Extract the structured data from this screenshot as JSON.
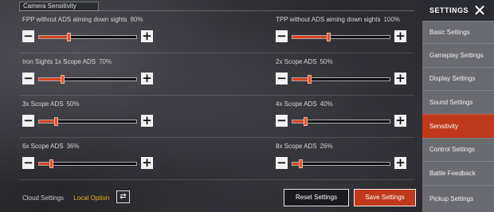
{
  "section_title": "Camera Sensitivity",
  "settings": [
    {
      "label": "FPP without ADS aiming down sights",
      "value": "80%",
      "level": 0.3
    },
    {
      "label": "TPP without ADS aiming down sights",
      "value": "100%",
      "level": 0.37
    },
    {
      "label": "Iron Sights 1x Scope ADS",
      "value": "70%",
      "level": 0.24
    },
    {
      "label": "2x Scope ADS",
      "value": "50%",
      "level": 0.17
    },
    {
      "label": "3x Scope ADS",
      "value": "50%",
      "level": 0.17
    },
    {
      "label": "4x Scope ADS",
      "value": "40%",
      "level": 0.13
    },
    {
      "label": "6x Scope ADS",
      "value": "36%",
      "level": 0.12
    },
    {
      "label": "8x Scope ADS",
      "value": "26%",
      "level": 0.08
    }
  ],
  "footer": {
    "cloud_label": "Cloud Settings",
    "local_option": "Local Option",
    "reset_label": "Reset Settings",
    "save_label": "Save Settings"
  },
  "sidebar": {
    "title": "SETTINGS",
    "close_glyph": "✕",
    "items": [
      {
        "label": "Basic Settings",
        "active": false
      },
      {
        "label": "Gameplay Settings",
        "active": false
      },
      {
        "label": "Display Settings",
        "active": false
      },
      {
        "label": "Sound Settings",
        "active": false
      },
      {
        "label": "Sensitivity",
        "active": true
      },
      {
        "label": "Control Settings",
        "active": false
      },
      {
        "label": "Battle Feedback",
        "active": false
      },
      {
        "label": "Pickup Settings",
        "active": false
      }
    ]
  },
  "colors": {
    "accent": "#c0391b",
    "slider_fill": "#d5431f",
    "local_option": "#f0b020"
  },
  "icons": {
    "minus": "−",
    "plus": "+",
    "swap": "⇄"
  }
}
